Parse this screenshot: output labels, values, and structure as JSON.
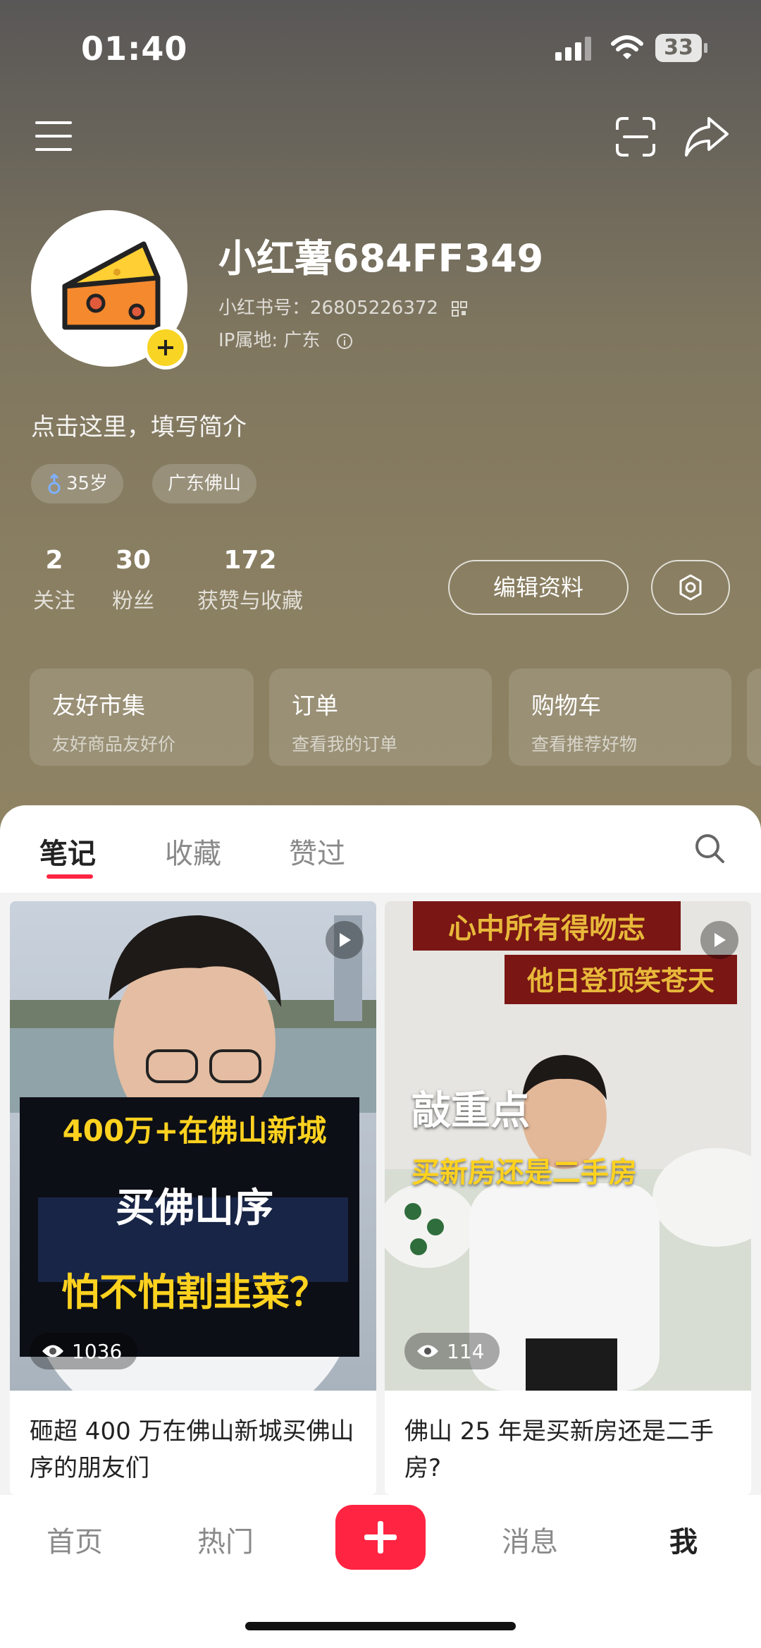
{
  "status": {
    "time": "01:40",
    "battery": "33"
  },
  "profile": {
    "nickname": "小红薯684FF349",
    "red_id": "小红书号：26805226372",
    "ip": "IP属地: 广东",
    "bio": "点击这里，填写简介",
    "tags": [
      "35岁",
      "广东佛山"
    ]
  },
  "stats": [
    {
      "num": "2",
      "label": "关注"
    },
    {
      "num": "30",
      "label": "粉丝"
    },
    {
      "num": "172",
      "label": "获赞与收藏"
    }
  ],
  "buttons": {
    "edit": "编辑资料"
  },
  "cards": [
    {
      "title": "友好市集",
      "sub": "友好商品友好价"
    },
    {
      "title": "订单",
      "sub": "查看我的订单"
    },
    {
      "title": "购物车",
      "sub": "查看推荐好物"
    }
  ],
  "tabs": [
    "笔记",
    "收藏",
    "赞过"
  ],
  "notes": [
    {
      "cover_lines": [
        "400万+在佛山新城",
        "买佛山序",
        "怕不怕割韭菜？"
      ],
      "views": "1036",
      "title": "砸超 400 万在佛山新城买佛山序的朋友们"
    },
    {
      "cover_lines": [
        "心中所有得吻志",
        "他日登顶笑苍天",
        "敲重点",
        "买新房还是二手房"
      ],
      "views": "114",
      "title": "佛山 25 年是买新房还是二手房?"
    }
  ],
  "nav": [
    "首页",
    "热门",
    "消息",
    "我"
  ],
  "colors": {
    "accent": "#ff2442",
    "header": "#8a7f62"
  }
}
